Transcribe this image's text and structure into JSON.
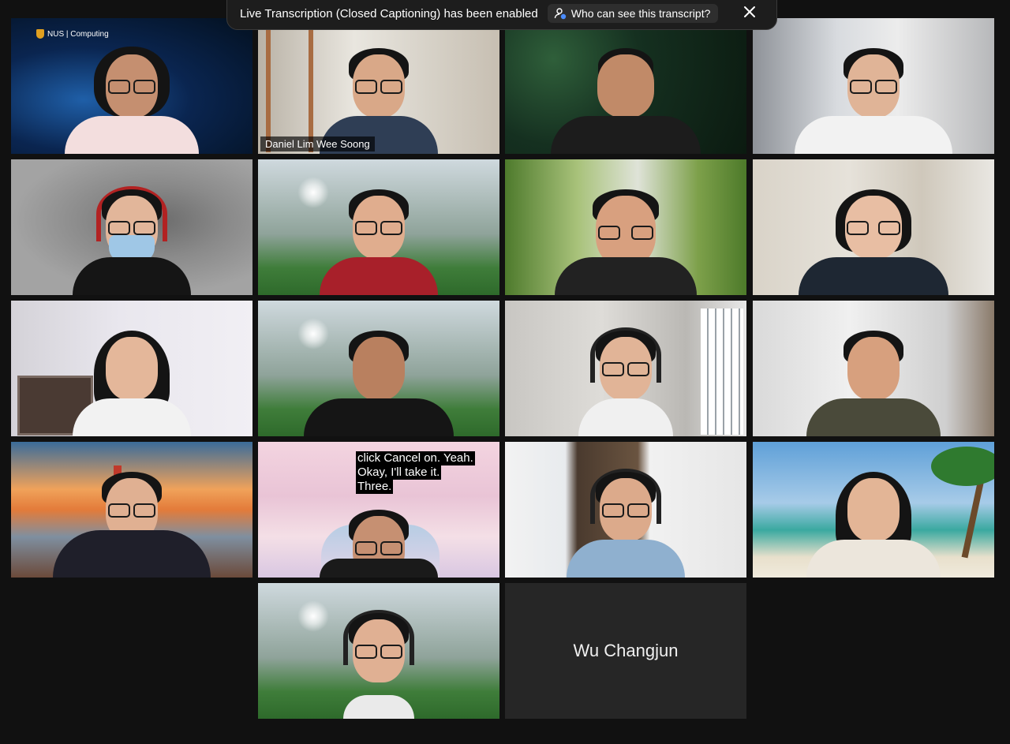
{
  "banner": {
    "message": "Live Transcription (Closed Captioning) has been enabled",
    "who_label": "Who can see this transcript?",
    "icons": {
      "who": "person-lock-icon",
      "close": "close-icon"
    }
  },
  "tiles": {
    "t1": {
      "logo_text": "NUS | Computing"
    },
    "t2": {
      "name": "Daniel Lim Wee Soong",
      "active": true
    },
    "t14": {
      "caption": [
        "click Cancel on. Yeah.",
        "Okay, I'll take it.",
        "Three."
      ]
    },
    "t18": {
      "name": "Wu Changjun"
    }
  },
  "colors": {
    "background": "#111111",
    "active_speaker_border": "#8cc63f",
    "tile_placeholder": "#2a2a2a"
  }
}
